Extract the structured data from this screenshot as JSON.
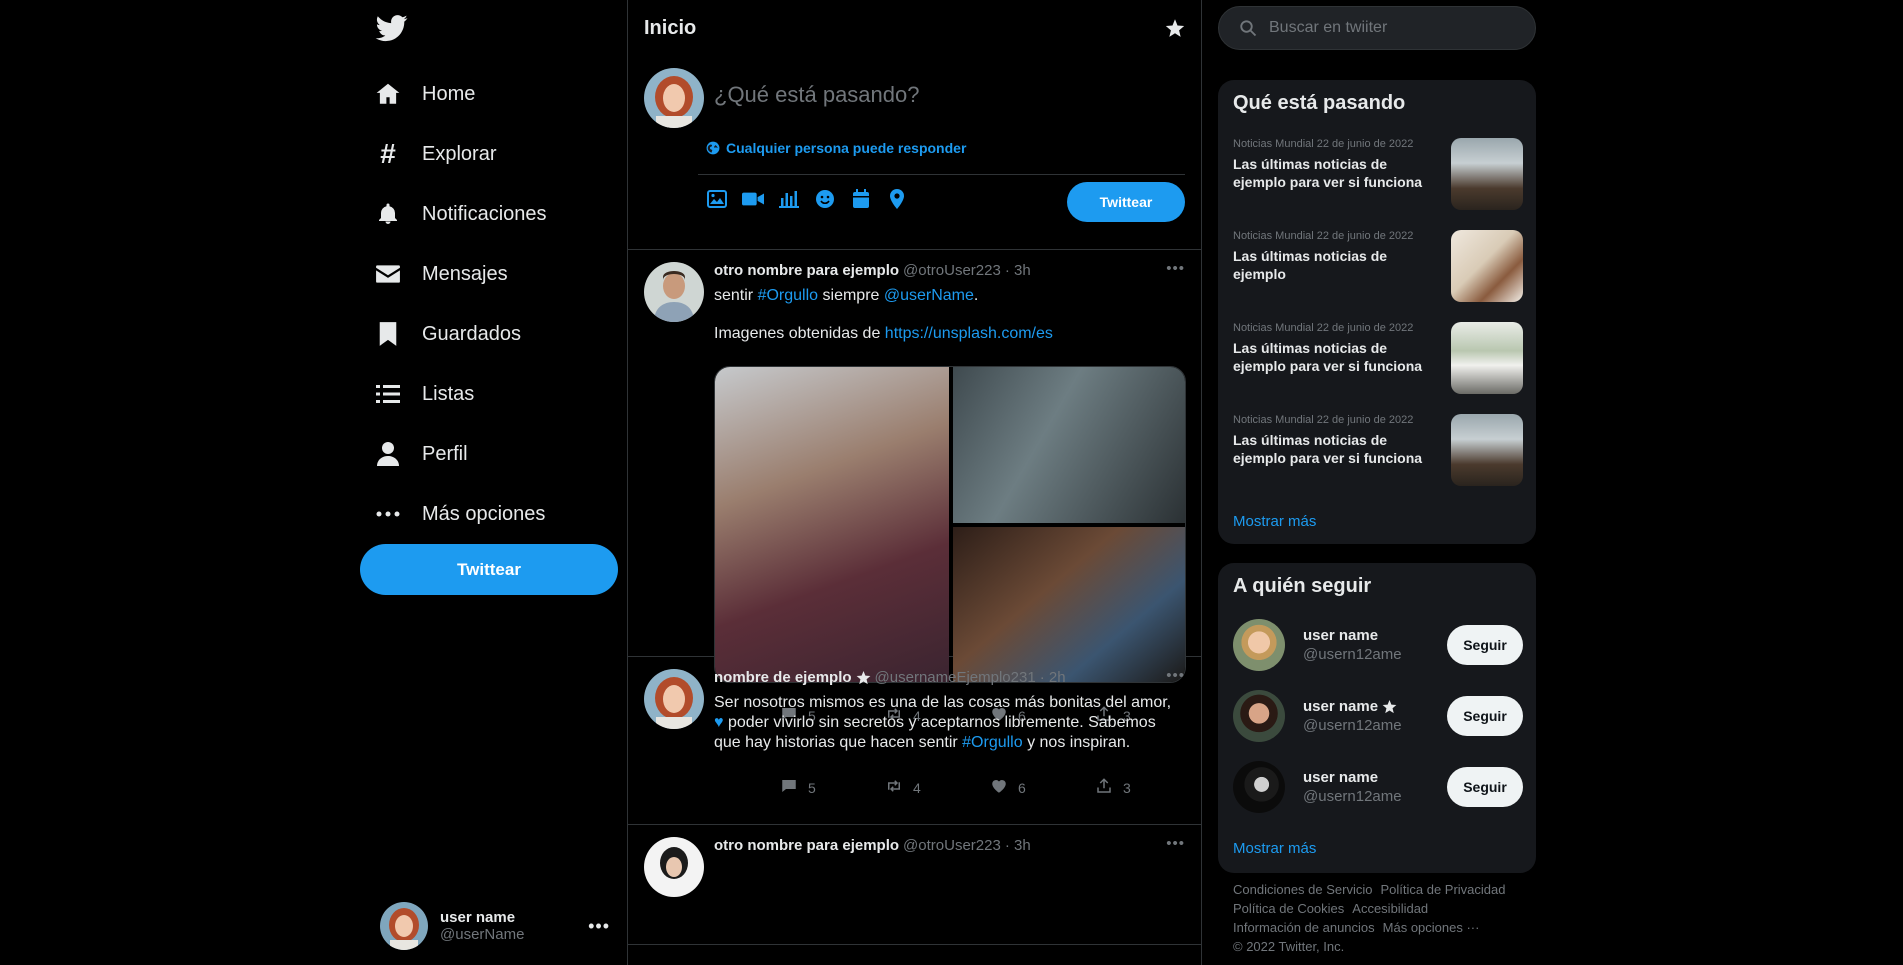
{
  "sidebar": {
    "nav": [
      {
        "label": "Home",
        "icon": "home-icon"
      },
      {
        "label": "Explorar",
        "icon": "hashtag-icon"
      },
      {
        "label": "Notificaciones",
        "icon": "bell-icon"
      },
      {
        "label": "Mensajes",
        "icon": "envelope-icon"
      },
      {
        "label": "Guardados",
        "icon": "bookmark-icon"
      },
      {
        "label": "Listas",
        "icon": "list-icon"
      },
      {
        "label": "Perfil",
        "icon": "user-icon"
      },
      {
        "label": "Más opciones",
        "icon": "more-icon"
      }
    ],
    "tweet_button": "Twittear",
    "account": {
      "name": "user name",
      "handle": "@userName"
    }
  },
  "main": {
    "title": "Inicio",
    "composer": {
      "placeholder": "¿Qué está pasando?",
      "reply_setting": "Cualquier persona puede responder",
      "tweet_button": "Twittear"
    },
    "posts": [
      {
        "name": "otro nombre para ejemplo",
        "handle": "@otroUser223",
        "time": "· 3h",
        "text_a": "sentir ",
        "hashtag": "#Orgullo",
        "text_b": " siempre ",
        "mention": "@userName",
        "text_c": ".",
        "line2_text": "Imagenes obtenidas de ",
        "line2_link": "https://unsplash.com/es",
        "replies": "5",
        "retweets": "4",
        "likes": "6",
        "shares": "3"
      },
      {
        "name": "nombre de ejemplo",
        "handle": "@usernameEjemplo231",
        "time": "· 2h",
        "text_a": "Ser nosotros mismos es una de las cosas más bonitas del amor,",
        "text_b": " poder vivirlo sin secretos y aceptarnos libremente. Sabemos que hay historias que hacen sentir ",
        "hashtag": "#Orgullo",
        "text_c": " y nos inspiran.",
        "replies": "5",
        "retweets": "4",
        "likes": "6",
        "shares": "3"
      },
      {
        "name": "otro nombre para ejemplo",
        "handle": "@otroUser223",
        "time": "· 3h"
      }
    ]
  },
  "right": {
    "search_placeholder": "Buscar en twiiter",
    "trends_title": "Qué está pasando",
    "trends": [
      {
        "meta": "Noticias Mundial 22 de junio de 2022",
        "title": "Las últimas noticias de ejemplo para ver si funciona"
      },
      {
        "meta": "Noticias Mundial 22 de junio de 2022",
        "title": "Las últimas noticias de ejemplo"
      },
      {
        "meta": "Noticias Mundial 22 de junio de 2022",
        "title": "Las últimas noticias de ejemplo para ver si funciona"
      },
      {
        "meta": "Noticias Mundial 22 de junio de 2022",
        "title": "Las últimas noticias de ejemplo para ver si funciona"
      }
    ],
    "trends_more": "Mostrar más",
    "follow_title": "A quién seguir",
    "follow": [
      {
        "name": "user name",
        "handle": "@usern12ame",
        "button": "Seguir"
      },
      {
        "name": "user name",
        "handle": "@usern12ame",
        "button": "Seguir"
      },
      {
        "name": "user name",
        "handle": "@usern12ame",
        "button": "Seguir"
      }
    ],
    "follow_more": "Mostrar más",
    "footer": {
      "l1a": "Condiciones de Servicio",
      "l1b": "Política de Privacidad",
      "l2a": "Política de Cookies",
      "l2b": "Accesibilidad",
      "l3a": "Información de anuncios",
      "l3b": "Más opciones ···",
      "l4": "© 2022 Twitter, Inc."
    }
  },
  "colors": {
    "accent": "#1d9bf0",
    "background": "#000000",
    "card": "#16181c"
  }
}
